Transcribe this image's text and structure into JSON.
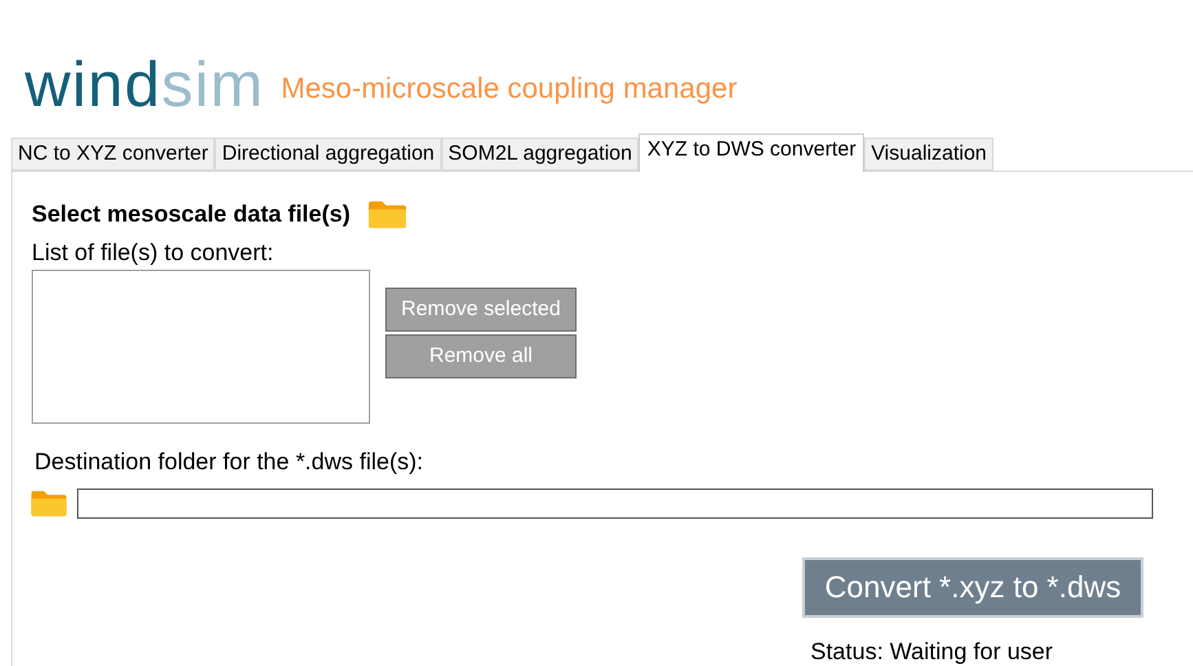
{
  "header": {
    "logo": [
      "wind",
      "sim"
    ],
    "title": "Meso-microscale coupling manager"
  },
  "tabs": [
    {
      "label": "NC to XYZ converter",
      "selected": false
    },
    {
      "label": "Directional aggregation",
      "selected": false
    },
    {
      "label": "SOM2L aggregation",
      "selected": false
    },
    {
      "label": "XYZ to DWS converter",
      "selected": true
    },
    {
      "label": "Visualization",
      "selected": false
    }
  ],
  "panel": {
    "heading": "Select mesoscale data file(s)",
    "list_label": "List of file(s) to convert:",
    "buttons": [
      "Remove selected",
      "Remove all"
    ],
    "destination_label": "Destination folder for the *.dws file(s):",
    "convert_button": "Convert *.xyz to *.dws",
    "status": "Status: Waiting for user"
  }
}
